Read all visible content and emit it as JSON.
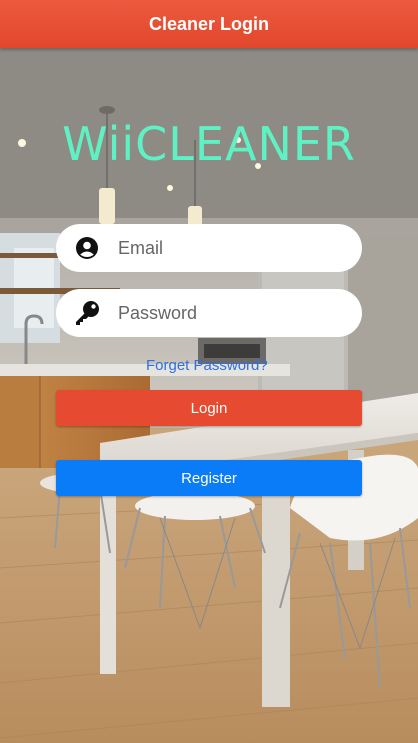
{
  "header": {
    "title": "Cleaner Login"
  },
  "logo": {
    "text": "WiiCLEANER",
    "color": "#5ff0c3"
  },
  "form": {
    "email": {
      "placeholder": "Email",
      "value": "",
      "icon": "user-circle-icon"
    },
    "password": {
      "placeholder": "Password",
      "value": "",
      "icon": "key-icon"
    },
    "forgot_link": "Forget Password?",
    "login_label": "Login",
    "register_label": "Register"
  },
  "colors": {
    "header": "#e2472d",
    "login_button": "#e64a31",
    "register_button": "#0b7cf8",
    "link": "#2f6fe0"
  }
}
